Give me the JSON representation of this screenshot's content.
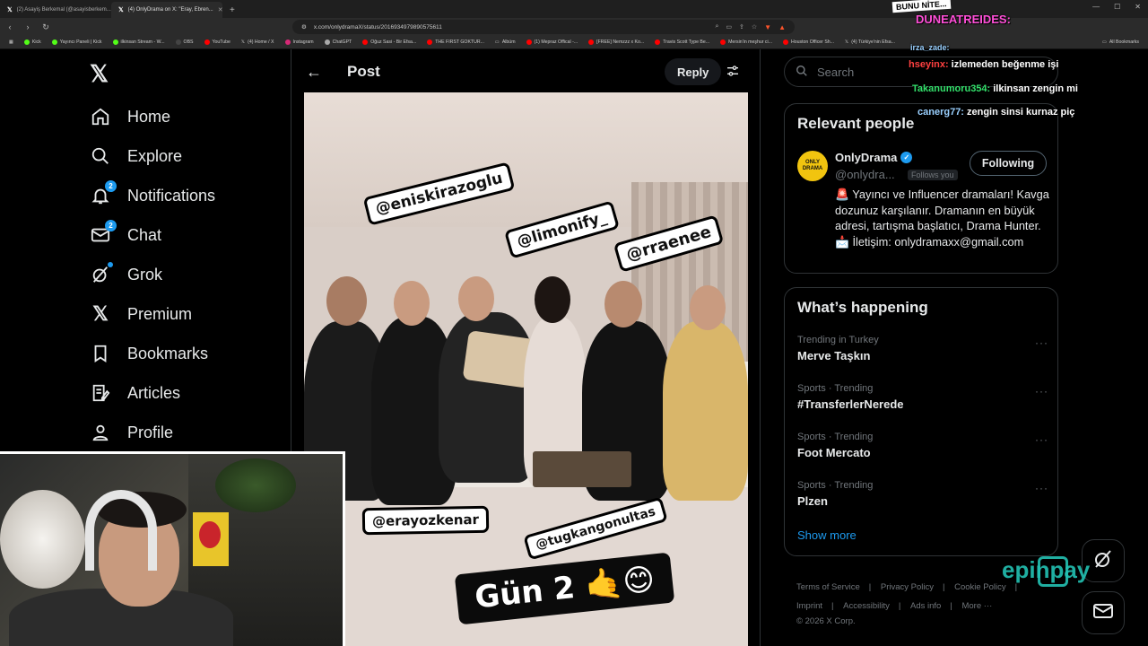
{
  "browser": {
    "tabs": [
      {
        "label": "(2) Asayiş Berkemal (@asayisberkem...",
        "active": false
      },
      {
        "label": "(4) OnlyDrama on X: \"Eray, Ebren...",
        "active": true
      }
    ],
    "url": "x.com/onlydramaX/status/2016934979890575611",
    "bookmarks": [
      "Kick",
      "Yayıncı Paneli | Kick",
      "ilkinsan Stream - W...",
      "OBS",
      "YouTube",
      "(4) Home / X",
      "Instagram",
      "ChatGPT",
      "Oğuz Sasi - Bir Efsa...",
      "THE FIRST GOKTUR...",
      "Albüm",
      "(1) Mepraz Offical -...",
      "[FREE] Nemzzz x Ko...",
      "Travis Scott Type Be...",
      "Mersin'in meşhur ci...",
      "Houston Officer Sh...",
      "(4) Türkiye'nin Efsa..."
    ],
    "all_bookmarks": "All Bookmarks"
  },
  "nav": {
    "items": [
      {
        "label": "Home",
        "icon": "home-icon"
      },
      {
        "label": "Explore",
        "icon": "search-icon"
      },
      {
        "label": "Notifications",
        "icon": "bell-icon",
        "badge": "2"
      },
      {
        "label": "Chat",
        "icon": "mail-icon",
        "badge": "2"
      },
      {
        "label": "Grok",
        "icon": "grok-icon"
      },
      {
        "label": "Premium",
        "icon": "x-icon"
      },
      {
        "label": "Bookmarks",
        "icon": "bookmark-icon"
      },
      {
        "label": "Articles",
        "icon": "article-icon"
      },
      {
        "label": "Profile",
        "icon": "person-icon"
      }
    ]
  },
  "post": {
    "title": "Post",
    "reply_label": "Reply",
    "tags": [
      "@eniskirazoglu",
      "@limonify_",
      "@rraenee",
      "@erayozkenar",
      "@tugkangonultas"
    ],
    "caption": "Gün 2 🤙😊"
  },
  "sidebar": {
    "search_placeholder": "Search",
    "relevant_title": "Relevant people",
    "person": {
      "avatar_text": "ONLY DRAMA",
      "name": "OnlyDrama",
      "handle": "@onlydra...",
      "follows_you": "Follows you",
      "follow_label": "Following",
      "bio_siren": "🚨",
      "bio": "Yayıncı ve Influencer dramaları! Kavga dozunuz karşılanır. Dramanın en büyük adresi, tartışma başlatıcı, Drama Hunter. 📩 İletişim: onlydramaxx@gmail.com"
    },
    "happening_title": "What’s happening",
    "trends": [
      {
        "context": "Trending in Turkey",
        "topic": "Merve Taşkın"
      },
      {
        "context": "Sports · Trending",
        "topic": "#TransferlerNerede"
      },
      {
        "context": "Sports · Trending",
        "topic": "Foot Mercato"
      },
      {
        "context": "Sports · Trending",
        "topic": "Plzen"
      }
    ],
    "show_more": "Show more",
    "footer": [
      "Terms of Service",
      "Privacy Policy",
      "Cookie Policy",
      "Imprint",
      "Accessibility",
      "Ads info",
      "More ···",
      "© 2026 X Corp."
    ]
  },
  "overlay": {
    "banner": "BUNU NİTE...",
    "chat": [
      {
        "user": "DUNEATREIDES:",
        "msg": "",
        "color": "#ff4fd8"
      },
      {
        "user": "irza_zade:",
        "msg": "",
        "color": "#9ad0ff"
      },
      {
        "user": "hseyinx:",
        "msg": "izlemeden beğenme işi",
        "color": "#ff4040"
      },
      {
        "user": "Takanumoru354:",
        "msg": "ilkinsan zengin mi",
        "color": "#33e06b"
      },
      {
        "user": "canerg77:",
        "msg": "zengin sinsi kurnaz piç",
        "color": "#9ad0ff"
      }
    ],
    "sponsor": "epinpay"
  },
  "colors": {
    "accent": "#1d9bf0",
    "bg": "#000000",
    "border": "#2f3336",
    "muted": "#71767b"
  }
}
